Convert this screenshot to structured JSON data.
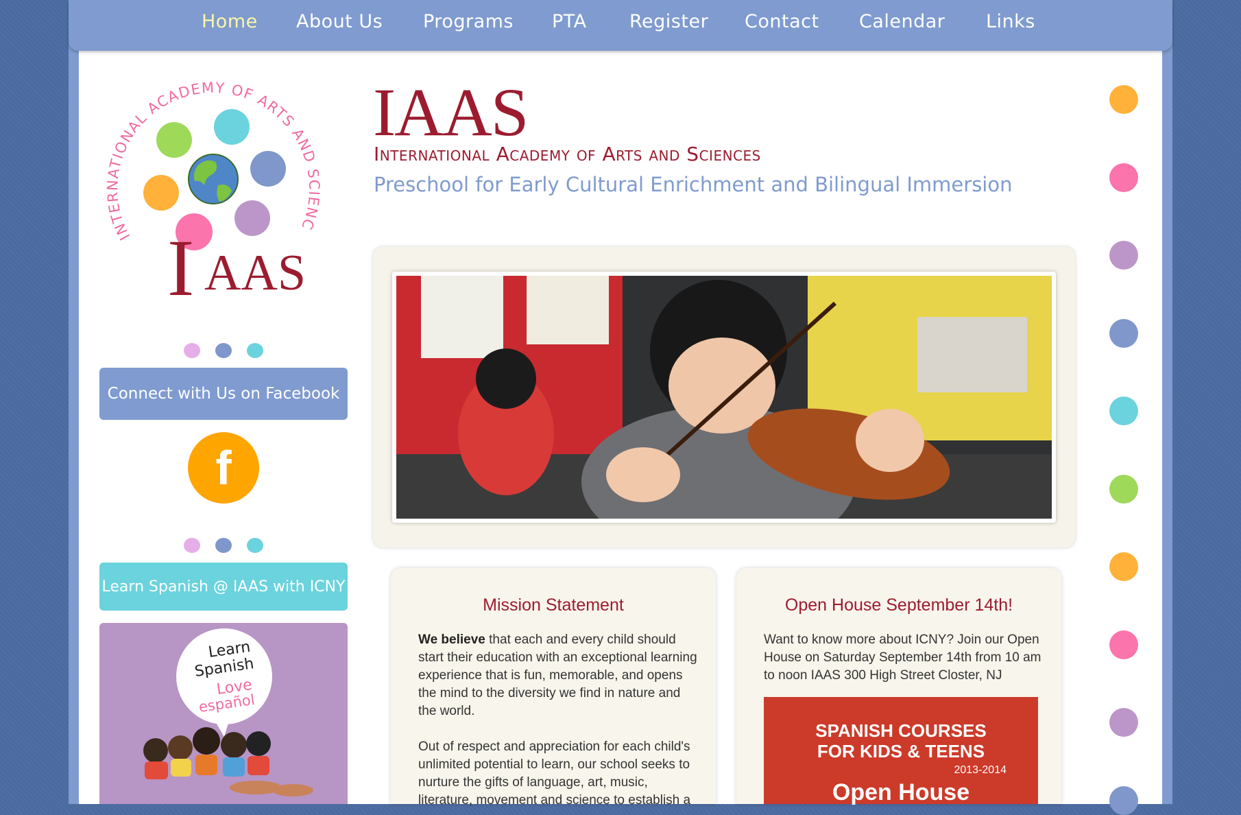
{
  "nav": {
    "items": [
      {
        "label": "Home",
        "active": true
      },
      {
        "label": "About Us"
      },
      {
        "label": "Programs"
      },
      {
        "label": "PTA"
      },
      {
        "label": "Register"
      },
      {
        "label": "Contact"
      },
      {
        "label": "Calendar"
      },
      {
        "label": "Links"
      }
    ]
  },
  "logo": {
    "arc_text": "INTERNATIONAL ACADEMY OF ARTS AND SCIENCES",
    "word": "IAAS"
  },
  "header": {
    "brand": "IAAS",
    "subtitle": "International Academy of Arts and Sciences",
    "tagline": "Preschool for Early Cultural Enrichment and Bilingual Immersion"
  },
  "sidebar": {
    "facebook_banner": "Connect with Us on Facebook",
    "facebook_glyph": "f",
    "spanish_banner": "Learn Spanish @ IAAS with ICNY",
    "spanish_bubble": {
      "line1": "Learn",
      "line2": "Spanish",
      "line3": "Love",
      "line4": "español"
    }
  },
  "mission": {
    "title": "Mission Statement",
    "lead": "We believe",
    "para1_rest": " that each and every child should start their education with an exceptional learning experience that is fun, memorable, and opens the mind to the diversity we find in nature and the world.",
    "para2": "Out of respect and appreciation for each child's unlimited potential to learn, our school seeks to nurture the gifts of language, art, music, literature, movement and science to establish a"
  },
  "openhouse": {
    "title": "Open House September 14th!",
    "text": "Want to know more about ICNY? Join our Open House on Saturday September 14th from 10 am to noon IAAS 300 High Street Closter, NJ",
    "poster": {
      "line1": "SPANISH COURSES",
      "line2": "FOR KIDS & TEENS",
      "years": "2013-2014",
      "cta": "Open House"
    }
  },
  "colors": {
    "nav_blue": "#7f9bcf",
    "brand_red": "#9c1c2f",
    "orange": "#ffb13a",
    "pink": "#fb74ab",
    "purple": "#bc96c9",
    "blue": "#7f97cb",
    "teal": "#6bd3dd",
    "green": "#9fd95a"
  },
  "side_dots": [
    "orange",
    "pink",
    "purple",
    "blue",
    "teal",
    "green",
    "orange",
    "pink",
    "purple",
    "blue"
  ]
}
